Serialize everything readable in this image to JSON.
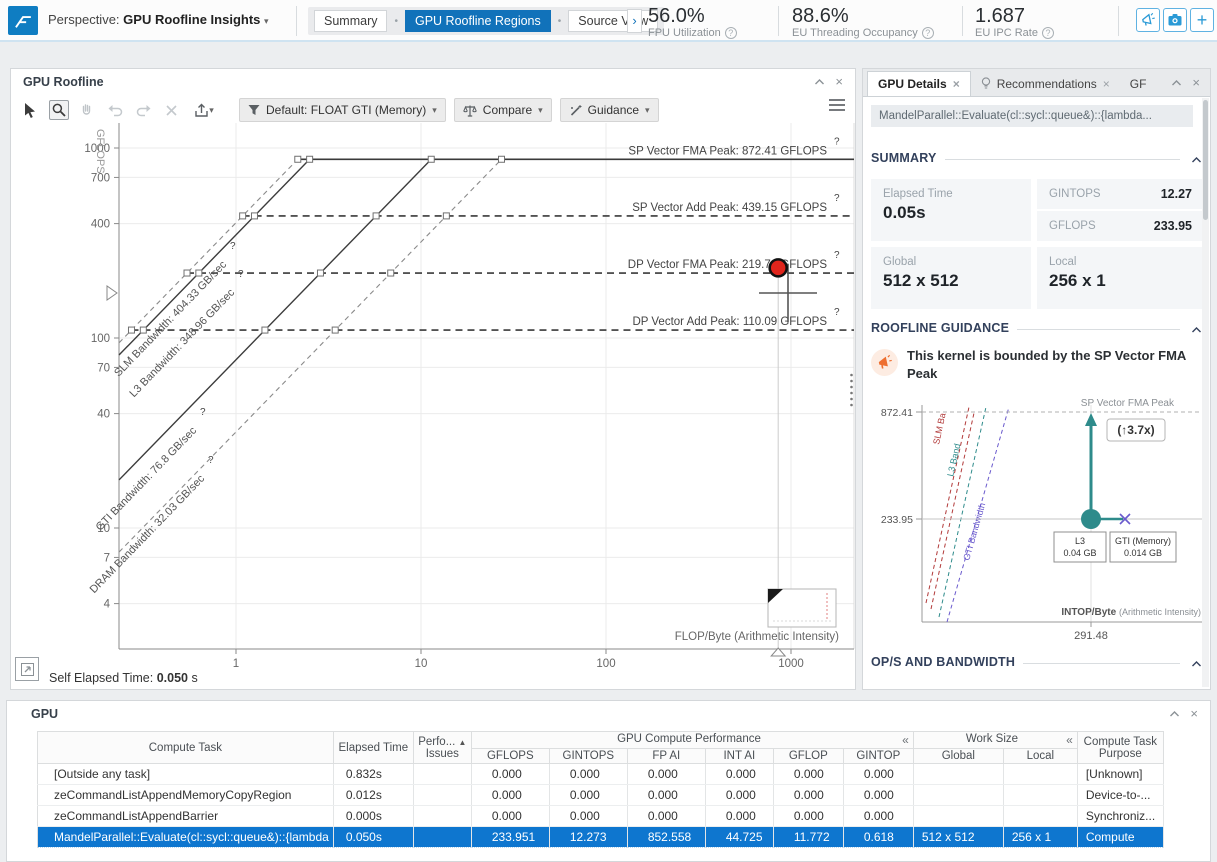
{
  "glyphs": {
    "caret_down": "▾",
    "separator_dot": "•",
    "expand_right": "›",
    "close": "×",
    "guillemet": "«",
    "sort_asc": "▲",
    "plus": "+"
  },
  "topbar": {
    "perspective_label": "Perspective:",
    "perspective_value": "GPU Roofline Insights",
    "nav_tabs": [
      {
        "label": "Summary",
        "active": false
      },
      {
        "label": "GPU Roofline Regions",
        "active": true
      },
      {
        "label": "Source View",
        "active": false
      }
    ],
    "metrics": [
      {
        "value": "56.0%",
        "label": "FPU Utilization"
      },
      {
        "value": "88.6%",
        "label": "EU Threading Occupancy"
      },
      {
        "value": "1.687",
        "label": "EU IPC Rate"
      }
    ]
  },
  "roofline_panel": {
    "title": "GPU Roofline",
    "filter_label": "Default: FLOAT GTI (Memory)",
    "compare_label": "Compare",
    "guidance_label": "Guidance",
    "footer": {
      "label": "Self Elapsed Time:",
      "value": "0.050",
      "unit": "s"
    }
  },
  "chart_data": {
    "type": "scatter",
    "title": "GPU Roofline",
    "xlabel": "FLOP/Byte (Arithmetic Intensity)",
    "ylabel": "GFLOPS",
    "x_ticks": [
      1,
      10,
      100,
      1000
    ],
    "y_ticks": [
      1000,
      700,
      400,
      100,
      70,
      40,
      10,
      7,
      4
    ],
    "xlim": [
      0.23,
      2300
    ],
    "ylim": [
      2.3,
      1390
    ],
    "legend_position": "none",
    "grid": true,
    "ceilings": [
      {
        "label": "SP Vector FMA Peak",
        "gflops": 872.41,
        "style": "solid"
      },
      {
        "label": "SP Vector Add Peak",
        "gflops": 439.15,
        "style": "dashed"
      },
      {
        "label": "DP Vector FMA Peak",
        "gflops": 219.76,
        "style": "dashed"
      },
      {
        "label": "DP Vector Add Peak",
        "gflops": 110.09,
        "style": "dashed"
      }
    ],
    "bandwidths": [
      {
        "label": "SLM Bandwidth",
        "gbsec": 404.33,
        "style": "dashed"
      },
      {
        "label": "L3 Bandwidth",
        "gbsec": 348.96,
        "style": "solid"
      },
      {
        "label": "GTI Bandwidth",
        "gbsec": 76.8,
        "style": "solid"
      },
      {
        "label": "DRAM Bandwidth",
        "gbsec": 32.03,
        "style": "dashed"
      }
    ],
    "points": [
      {
        "name": "MandelParallel::Evaluate",
        "x": 852.558,
        "y": 233.951,
        "color": "#e0251c"
      }
    ]
  },
  "details_panel": {
    "tabs": [
      {
        "label": "GPU Details",
        "active": true,
        "icon": null
      },
      {
        "label": "Recommendations",
        "active": false,
        "icon": "bulb"
      },
      {
        "label": "GF",
        "active": false,
        "icon": null
      }
    ],
    "kernel_name": "MandelParallel::Evaluate(cl::sycl::queue&)::{lambda...",
    "summary_title": "SUMMARY",
    "summary_cards": {
      "elapsed_label": "Elapsed Time",
      "elapsed_value": "0.05s",
      "gintops_label": "GINTOPS",
      "gintops_value": "12.27",
      "gflops_label": "GFLOPS",
      "gflops_value": "233.95",
      "global_label": "Global",
      "global_value": "512 x 512",
      "local_label": "Local",
      "local_value": "256 x 1"
    },
    "guidance_title": "ROOFLINE GUIDANCE",
    "guidance_message": "This kernel is bounded by the SP Vector FMA Peak",
    "ops_title": "OP/S AND BANDWIDTH"
  },
  "guidance_chart": {
    "type": "roofline-guidance",
    "y_peak_label": "872.41",
    "y_point_label": "233.95",
    "peak_line_label": "SP Vector FMA Peak",
    "speedup_label": "(↑3.7x)",
    "xlabel": "INTOP/Byte",
    "xlabel_sub": "(Arithmetic Intensity)",
    "x_tick": "291.48",
    "callouts": [
      {
        "title": "L3",
        "value": "0.04 GB"
      },
      {
        "title": "GTI (Memory)",
        "value": "0.014 GB"
      }
    ],
    "diagonals": [
      {
        "label": "SLM Ba",
        "color": "#b23a3a"
      },
      {
        "label": "L3 Band",
        "color": "#2e8b8b"
      },
      {
        "label": "GTI Bandwidth",
        "color": "#6a5acd"
      }
    ]
  },
  "gpu_table": {
    "title": "GPU",
    "headers": {
      "compute_task": "Compute Task",
      "elapsed_time": "Elapsed Time",
      "perf_line1": "Perfo...",
      "perf_line2": "Issues",
      "group_perf": "GPU Compute Performance",
      "group_work": "Work Size",
      "purpose_line1": "Compute Task",
      "purpose_line2": "Purpose",
      "sub_columns": [
        "GFLOPS",
        "GINTOPS",
        "FP AI",
        "INT AI",
        "GFLOP",
        "GINTOP",
        "Global",
        "Local"
      ]
    },
    "rows": [
      {
        "task": "[Outside any task]",
        "elapsed": "0.832s",
        "issues": "",
        "values": [
          "0.000",
          "0.000",
          "0.000",
          "0.000",
          "0.000",
          "0.000"
        ],
        "global": "",
        "local": "",
        "purpose": "[Unknown]",
        "selected": false
      },
      {
        "task": "zeCommandListAppendMemoryCopyRegion",
        "elapsed": "0.012s",
        "issues": "",
        "values": [
          "0.000",
          "0.000",
          "0.000",
          "0.000",
          "0.000",
          "0.000"
        ],
        "global": "",
        "local": "",
        "purpose": "Device-to-...",
        "selected": false
      },
      {
        "task": "zeCommandListAppendBarrier",
        "elapsed": "0.000s",
        "issues": "",
        "values": [
          "0.000",
          "0.000",
          "0.000",
          "0.000",
          "0.000",
          "0.000"
        ],
        "global": "",
        "local": "",
        "purpose": "Synchroniz...",
        "selected": false
      },
      {
        "task": "MandelParallel::Evaluate(cl::sycl::queue&)::{lambda",
        "elapsed": "0.050s",
        "issues": "",
        "values": [
          "233.951",
          "12.273",
          "852.558",
          "44.725",
          "11.772",
          "0.618"
        ],
        "global": "512 x 512",
        "local": "256 x 1",
        "purpose": "Compute",
        "selected": true
      }
    ]
  },
  "colors": {
    "accent_blue": "#1172ba",
    "selected_row": "#0e76cf",
    "dot_red": "#e0251c",
    "teal": "#2e8b8b",
    "purple": "#6a5acd",
    "orange": "#ee6f30"
  }
}
